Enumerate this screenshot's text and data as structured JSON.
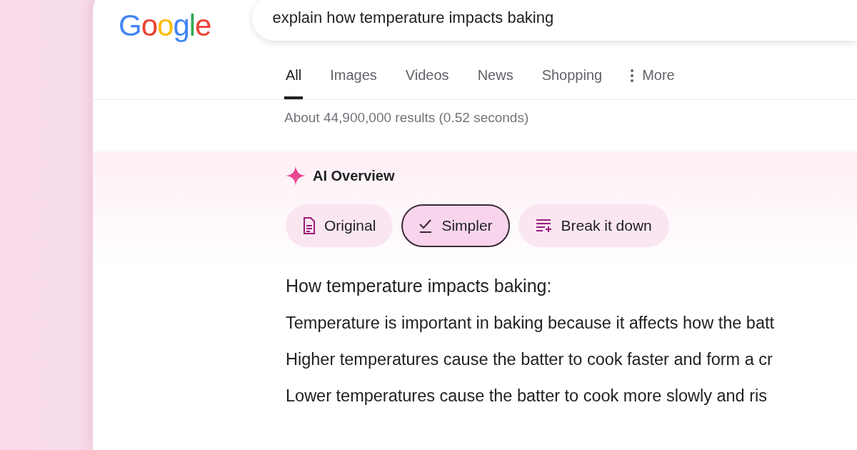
{
  "logo": "Google",
  "search": {
    "value": "explain how temperature impacts baking"
  },
  "tabs": [
    {
      "label": "All",
      "selected": true
    },
    {
      "label": "Images",
      "selected": false
    },
    {
      "label": "Videos",
      "selected": false
    },
    {
      "label": "News",
      "selected": false
    },
    {
      "label": "Shopping",
      "selected": false
    },
    {
      "label": "More",
      "selected": false,
      "kind": "more"
    }
  ],
  "result_stats": "About 44,900,000 results (0.52 seconds)",
  "ai_overview": {
    "title": "AI Overview",
    "chips": [
      {
        "label": "Original",
        "kind": "document",
        "selected": false
      },
      {
        "label": "Simpler",
        "kind": "check",
        "selected": true
      },
      {
        "label": "Break it down",
        "kind": "list",
        "selected": false
      }
    ],
    "heading": "How temperature impacts baking:",
    "lines": [
      "Temperature is important in baking because it affects how the batt",
      "Higher temperatures cause the batter to cook faster and form a cr",
      "Lower temperatures cause the batter to cook more slowly and ris"
    ]
  }
}
